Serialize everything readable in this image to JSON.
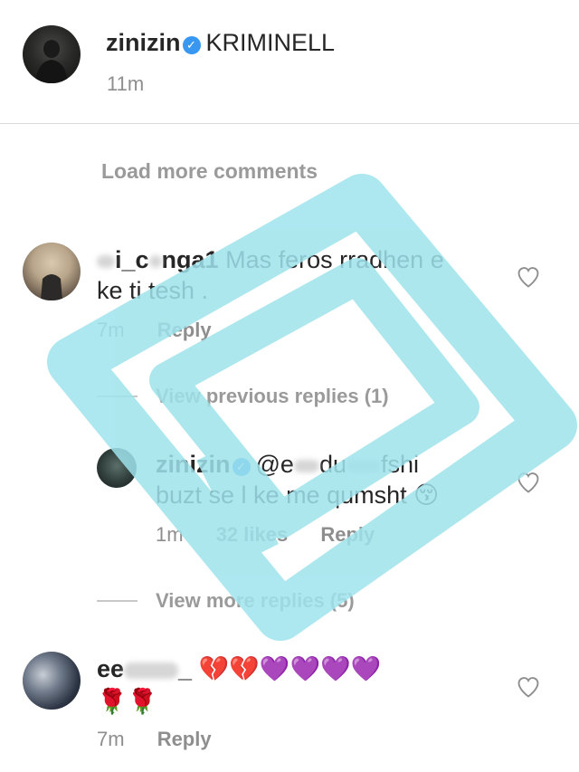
{
  "post": {
    "username": "zinizin",
    "caption": "KRIMINELL",
    "time": "11m"
  },
  "load_more": "Load more comments",
  "comments": [
    {
      "username_visible": "i_c",
      "username_visible_2": "nga1",
      "text_line1": "Mas feros rradhen e",
      "text_line2": "ke ti tesh .",
      "time": "7m",
      "reply_label": "Reply"
    }
  ],
  "thread": {
    "view_previous": "View previous replies (1)",
    "view_more": "View more replies (5)"
  },
  "reply": {
    "username": "zinizin",
    "mention_start": "@e",
    "mention_mid": "du",
    "mention_end": "fshi",
    "text_line2": "buzt se l ke me qumsht",
    "emoji": "😚",
    "time": "1m",
    "likes": "32 likes",
    "reply_label": "Reply"
  },
  "comment2": {
    "username_visible": "ee",
    "username_tail": "_",
    "emojis_line1": "💔💔💜💜💜💜",
    "emojis_line2": "🌹🌹",
    "time": "7m",
    "reply_label": "Reply"
  },
  "colors": {
    "watermark": "#9fe3ec",
    "verified": "#3897f0",
    "meta": "#8e8e8e",
    "divider": "#dbdbdb"
  }
}
